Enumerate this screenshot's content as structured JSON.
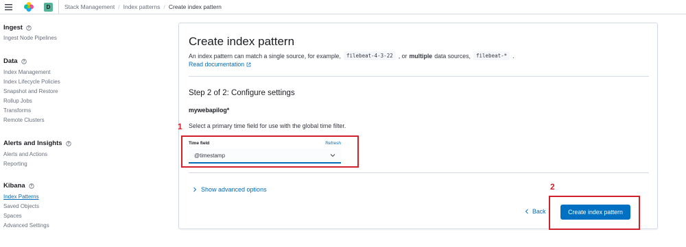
{
  "header": {
    "space_initial": "D",
    "breadcrumbs": [
      "Stack Management",
      "Index patterns",
      "Create index pattern"
    ]
  },
  "sidebar": {
    "groups": [
      {
        "title": "Ingest",
        "items": [
          "Ingest Node Pipelines"
        ]
      },
      {
        "title": "Data",
        "items": [
          "Index Management",
          "Index Lifecycle Policies",
          "Snapshot and Restore",
          "Rollup Jobs",
          "Transforms",
          "Remote Clusters"
        ]
      },
      {
        "title": "Alerts and Insights",
        "items": [
          "Alerts and Actions",
          "Reporting"
        ]
      },
      {
        "title": "Kibana",
        "items": [
          "Index Patterns",
          "Saved Objects",
          "Spaces",
          "Advanced Settings"
        ]
      }
    ],
    "active_item": "Index Patterns"
  },
  "main": {
    "title": "Create index pattern",
    "desc_part1": "An index pattern can match a single source, for example,",
    "code_example1": "filebeat-4-3-22",
    "desc_part2": ", or",
    "desc_bold": "multiple",
    "desc_part3": "data sources,",
    "code_example2": "filebeat-*",
    "desc_end": ".",
    "doc_link": "Read documentation",
    "step_title": "Step 2 of 2: Configure settings",
    "pattern_name": "mywebapilog*",
    "instructions": "Select a primary time field for use with the global time filter.",
    "time_field_label": "Time field",
    "refresh_label": "Refresh",
    "time_field_value": "@timestamp",
    "advanced_toggle": "Show advanced options",
    "back_label": "Back",
    "create_button": "Create index pattern"
  },
  "annotations": [
    "1",
    "2"
  ],
  "colors": {
    "primary": "#0071c2",
    "link": "#006bb8",
    "annotation": "#d0212a",
    "space_avatar": "#54b399"
  },
  "icons": [
    "menu-icon",
    "elastic-logo",
    "help-icon",
    "external-link-icon",
    "chevron-down-icon",
    "chevron-right-icon",
    "chevron-left-icon"
  ]
}
